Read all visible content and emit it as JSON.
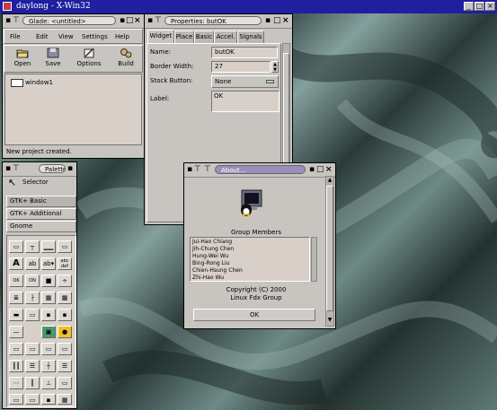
{
  "screen": {
    "title": "daylong - X-Win32"
  },
  "glade": {
    "title": "Glade: <untitled>",
    "menu": [
      "File",
      "Edit",
      "View",
      "Settings",
      "Help"
    ],
    "toolbar": [
      {
        "label": "Open",
        "icon": "folder-open-icon"
      },
      {
        "label": "Save",
        "icon": "floppy-disk-icon"
      },
      {
        "label": "Options",
        "icon": "options-icon"
      },
      {
        "label": "Build",
        "icon": "gears-icon"
      }
    ],
    "tree_item": "window1",
    "status": "New project created."
  },
  "properties": {
    "title": "Properties: butOK",
    "tabs": [
      "Widget",
      "Place",
      "Basic",
      "Accel.",
      "Signals"
    ],
    "name_label": "Name:",
    "name_value": "butOK",
    "border_label": "Border Width:",
    "border_value": "27",
    "stock_label": "Stock Button:",
    "stock_value": "None",
    "label_label": "Label:",
    "label_value": "OK"
  },
  "palette": {
    "title": "Palette",
    "selector": "Selector",
    "sections": [
      "GTK+ Basic",
      "GTK+ Additional",
      "Gnome"
    ]
  },
  "about": {
    "title": "About...",
    "group_heading": "Group Members",
    "members": [
      "Jui-Hao Chiang",
      "Jih-Chung Chen",
      "Hung-Wei Wu",
      "Bing-Rong Liu",
      "Chien-Hsung Chen",
      "Zhi-Hao Wu"
    ],
    "copyright": "Copyright (C) 2000",
    "group": "Linux Fdx Group",
    "ok": "OK"
  },
  "colors": {
    "desktop": "#3f5a58",
    "titlebar": "#1f1fa0",
    "active_pill": "#9a8fb8",
    "panel": "#c8c4c0"
  }
}
